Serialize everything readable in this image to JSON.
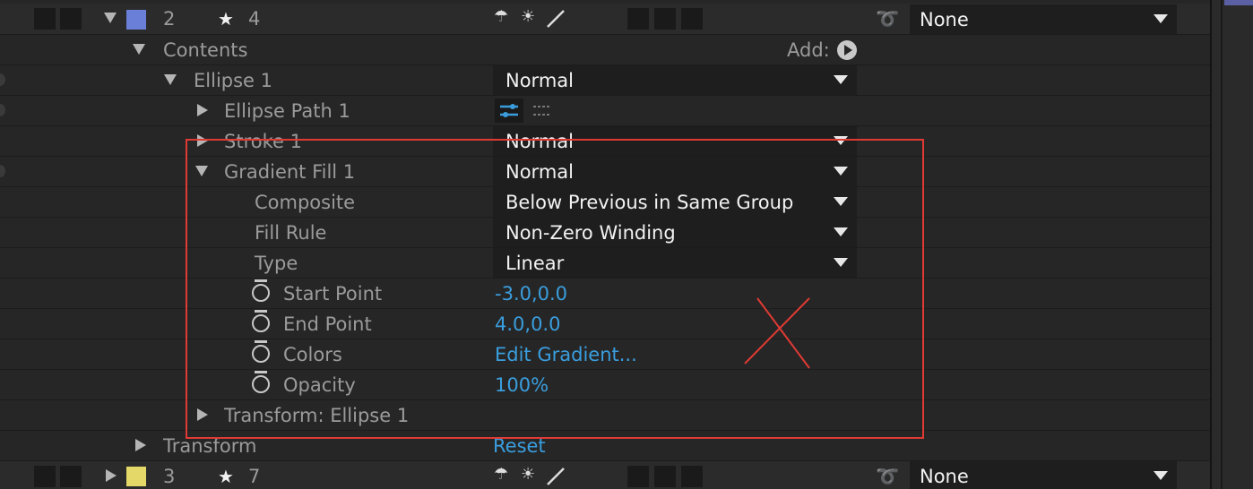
{
  "layers": [
    {
      "number": "2",
      "source_index": "4",
      "label_color": "#6a7fd8",
      "parent": "None"
    },
    {
      "number": "3",
      "source_index": "7",
      "label_color": "#e4d869",
      "parent": "None"
    }
  ],
  "tree": {
    "contents": "Contents",
    "add_label": "Add:",
    "ellipse_group": {
      "label": "Ellipse 1",
      "blend_mode": "Normal"
    },
    "ellipse_path": "Ellipse Path 1",
    "stroke": {
      "label": "Stroke 1",
      "blend_mode": "Normal"
    },
    "gradient_fill": {
      "label": "Gradient Fill 1",
      "blend_mode": "Normal"
    },
    "composite": {
      "label": "Composite",
      "value": "Below Previous in Same Group"
    },
    "fill_rule": {
      "label": "Fill Rule",
      "value": "Non-Zero Winding"
    },
    "type": {
      "label": "Type",
      "value": "Linear"
    },
    "start_point": {
      "label": "Start Point",
      "value": "-3.0,0.0"
    },
    "end_point": {
      "label": "End Point",
      "value": "4.0,0.0"
    },
    "colors": {
      "label": "Colors",
      "value": "Edit Gradient..."
    },
    "opacity": {
      "label": "Opacity",
      "value": "100%"
    },
    "transform_ellipse": "Transform: Ellipse 1",
    "transform": {
      "label": "Transform",
      "value": "Reset"
    }
  },
  "colors": {
    "link": "#3a9ede",
    "annotation_red": "#e03a34",
    "background": "#262626"
  }
}
